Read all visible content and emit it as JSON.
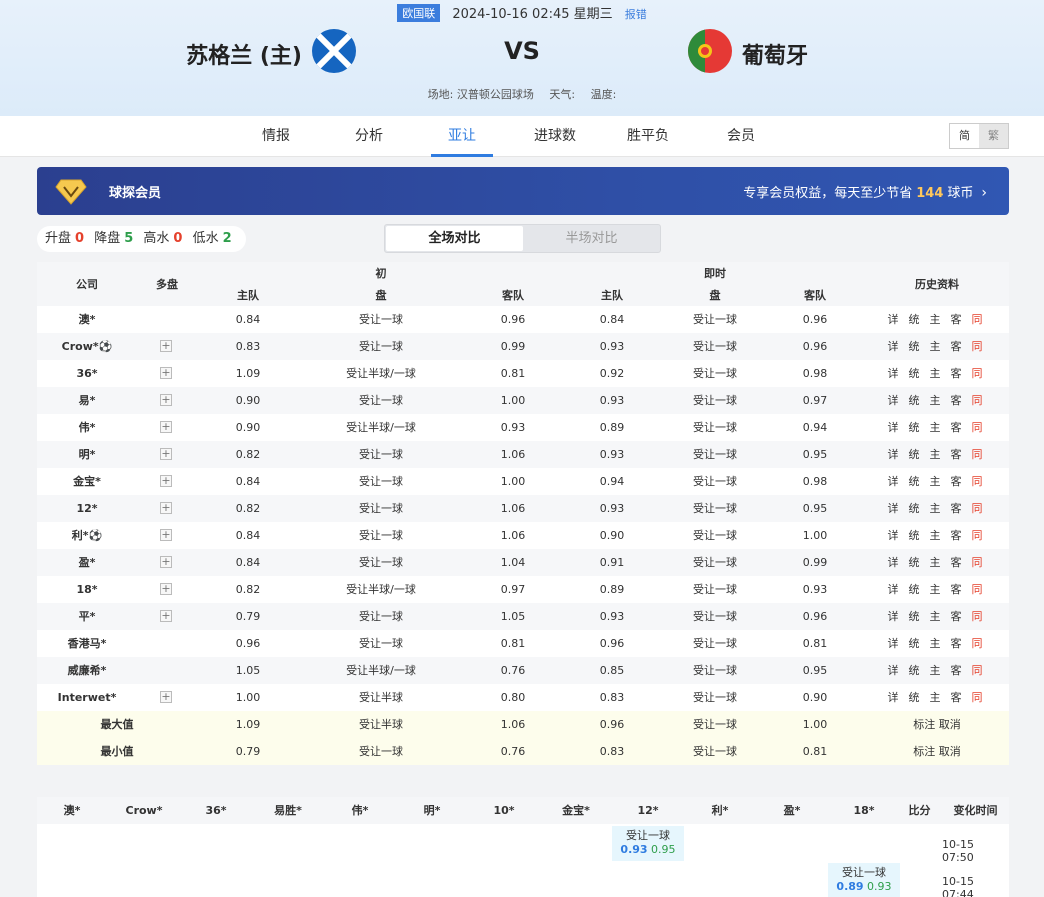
{
  "match": {
    "league": "欧国联",
    "datetime": "2024-10-16 02:45 星期三",
    "report": "报错",
    "home": "苏格兰 (主)",
    "away": "葡萄牙",
    "vs": "VS",
    "venue": "场地: 汉普顿公园球场",
    "weather": "天气:",
    "temperature": "温度:"
  },
  "tabs": [
    "情报",
    "分析",
    "亚让",
    "进球数",
    "胜平负",
    "会员"
  ],
  "active_tab": "亚让",
  "lang": {
    "simplified": "简",
    "traditional": "繁"
  },
  "vip": {
    "title": "球探会员",
    "desc_pre": "专享会员权益，每天至少节省",
    "amount": "144",
    "desc_post": "球币"
  },
  "summary": {
    "up_label": "升盘",
    "up": "0",
    "down_label": "降盘",
    "down": "5",
    "high_label": "高水",
    "high": "0",
    "low_label": "低水",
    "low": "2"
  },
  "segment": {
    "full": "全场对比",
    "half": "半场对比"
  },
  "table_head": {
    "company": "公司",
    "multi": "多盘",
    "initial": "初",
    "live": "即时",
    "history": "历史资料",
    "home": "主队",
    "line": "盘",
    "away": "客队"
  },
  "tool_labels": [
    "详",
    "统",
    "主",
    "客",
    "同"
  ],
  "rows": [
    {
      "company": "澳*",
      "plus": false,
      "i_home": "0.84",
      "i_line": "受让一球",
      "i_away": "0.96",
      "l_home": "0.84",
      "l_line": "受让一球",
      "l_away": "0.96"
    },
    {
      "company": "Crow*⚽",
      "plus": true,
      "i_home": "0.83",
      "i_line": "受让一球",
      "i_away": "0.99",
      "l_home": "0.93",
      "l_line": "受让一球",
      "l_away": "0.96"
    },
    {
      "company": "36*",
      "plus": true,
      "i_home": "1.09",
      "i_line": "受让半球/一球",
      "i_away": "0.81",
      "l_home": "0.92",
      "l_line": "受让一球",
      "l_away": "0.98"
    },
    {
      "company": "易*",
      "plus": true,
      "i_home": "0.90",
      "i_line": "受让一球",
      "i_away": "1.00",
      "l_home": "0.93",
      "l_line": "受让一球",
      "l_away": "0.97"
    },
    {
      "company": "伟*",
      "plus": true,
      "i_home": "0.90",
      "i_line": "受让半球/一球",
      "i_away": "0.93",
      "l_home": "0.89",
      "l_line": "受让一球",
      "l_away": "0.94"
    },
    {
      "company": "明*",
      "plus": true,
      "i_home": "0.82",
      "i_line": "受让一球",
      "i_away": "1.06",
      "l_home": "0.93",
      "l_line": "受让一球",
      "l_away": "0.95"
    },
    {
      "company": "金宝*",
      "plus": true,
      "i_home": "0.84",
      "i_line": "受让一球",
      "i_away": "1.00",
      "l_home": "0.94",
      "l_line": "受让一球",
      "l_away": "0.98"
    },
    {
      "company": "12*",
      "plus": true,
      "i_home": "0.82",
      "i_line": "受让一球",
      "i_away": "1.06",
      "l_home": "0.93",
      "l_line": "受让一球",
      "l_away": "0.95"
    },
    {
      "company": "利*⚽",
      "plus": true,
      "i_home": "0.84",
      "i_line": "受让一球",
      "i_away": "1.06",
      "l_home": "0.90",
      "l_line": "受让一球",
      "l_away": "1.00"
    },
    {
      "company": "盈*",
      "plus": true,
      "i_home": "0.84",
      "i_line": "受让一球",
      "i_away": "1.04",
      "l_home": "0.91",
      "l_line": "受让一球",
      "l_away": "0.99"
    },
    {
      "company": "18*",
      "plus": true,
      "i_home": "0.82",
      "i_line": "受让半球/一球",
      "i_away": "0.97",
      "l_home": "0.89",
      "l_line": "受让一球",
      "l_away": "0.93"
    },
    {
      "company": "平*",
      "plus": true,
      "i_home": "0.79",
      "i_line": "受让一球",
      "i_away": "1.05",
      "l_home": "0.93",
      "l_line": "受让一球",
      "l_away": "0.96"
    },
    {
      "company": "香港马*",
      "plus": false,
      "i_home": "0.96",
      "i_line": "受让一球",
      "i_away": "0.81",
      "l_home": "0.96",
      "l_line": "受让一球",
      "l_away": "0.81"
    },
    {
      "company": "威廉希*",
      "plus": false,
      "i_home": "1.05",
      "i_line": "受让半球/一球",
      "i_away": "0.76",
      "l_home": "0.85",
      "l_line": "受让一球",
      "l_away": "0.95"
    },
    {
      "company": "Interwet*",
      "plus": true,
      "i_home": "1.00",
      "i_line": "受让半球",
      "i_away": "0.80",
      "l_home": "0.83",
      "l_line": "受让一球",
      "l_away": "0.90"
    }
  ],
  "stats": [
    {
      "label": "最大值",
      "i_home": "1.09",
      "i_line": "受让半球",
      "i_away": "1.06",
      "l_home": "0.96",
      "l_line": "受让一球",
      "l_away": "1.00",
      "action": "标注 取消"
    },
    {
      "label": "最小值",
      "i_home": "0.79",
      "i_line": "受让一球",
      "i_away": "0.76",
      "l_home": "0.83",
      "l_line": "受让一球",
      "l_away": "0.81",
      "action": "标注 取消"
    }
  ],
  "change_head": [
    "澳*",
    "Crow*",
    "36*",
    "易胜*",
    "伟*",
    "明*",
    "10*",
    "金宝*",
    "12*",
    "利*",
    "盈*",
    "18*",
    "比分",
    "变化时间"
  ],
  "changes": [
    {
      "col": 8,
      "line": "受让一球",
      "home": "0.93",
      "away": "0.95",
      "time": "10-15 07:50"
    },
    {
      "col": 11,
      "line": "受让一球",
      "home": "0.89",
      "away": "0.93",
      "time": "10-15 07:44"
    }
  ],
  "colors": {
    "accent": "#2f7ce0",
    "up": "#e5412c",
    "down": "#2e9e4b",
    "vip_bg": "#2f4fa6"
  }
}
